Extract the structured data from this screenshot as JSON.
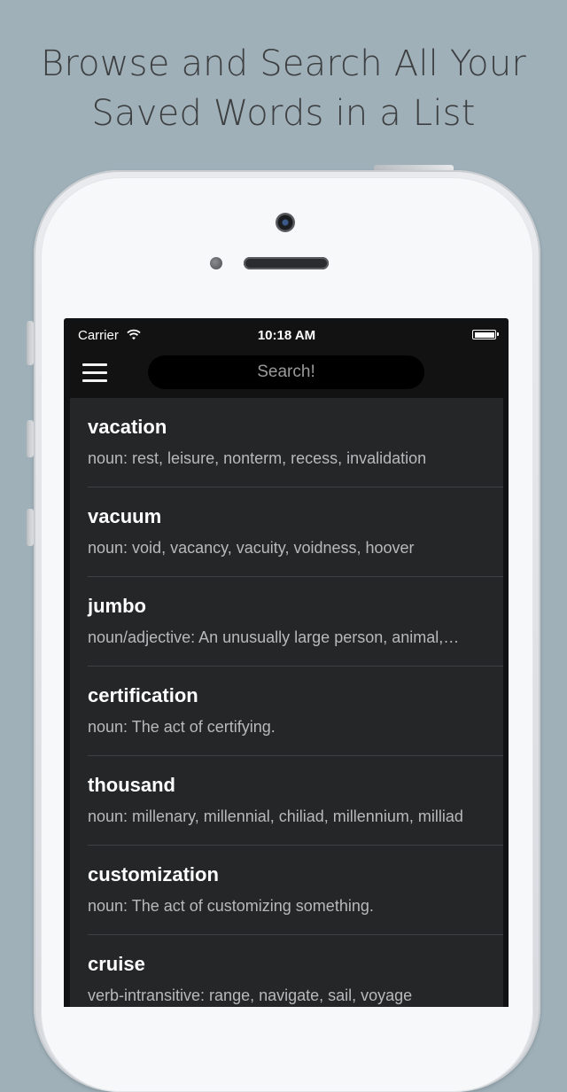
{
  "headline": {
    "line1": "Browse and Search All Your",
    "line2": "Saved Words in a List"
  },
  "status_bar": {
    "carrier": "Carrier",
    "time": "10:18 AM"
  },
  "search": {
    "placeholder": "Search!"
  },
  "colors": {
    "background": "#9fb0b9",
    "screen": "#252628",
    "bar": "#121212"
  },
  "words": [
    {
      "word": "vacation",
      "definition": "noun: rest, leisure, nonterm, recess, invalidation"
    },
    {
      "word": "vacuum",
      "definition": "noun: void, vacancy, vacuity, voidness, hoover"
    },
    {
      "word": "jumbo",
      "definition": "noun/adjective: An unusually large person, animal,…"
    },
    {
      "word": "certification",
      "definition": "noun: The act of certifying."
    },
    {
      "word": "thousand",
      "definition": "noun: millenary, millennial, chiliad, millennium, milliad"
    },
    {
      "word": "customization",
      "definition": "noun: The act of customizing something."
    },
    {
      "word": "cruise",
      "definition": "verb-intransitive: range, navigate, sail, voyage"
    }
  ]
}
